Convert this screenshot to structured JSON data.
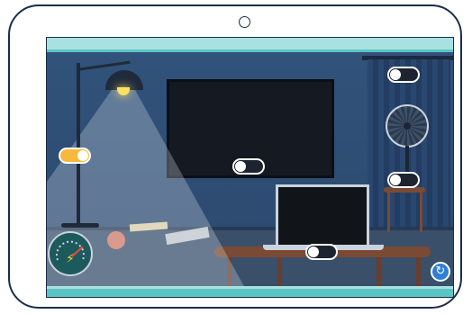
{
  "scene": {
    "accent_color": "#5cc4c4",
    "wall_color": "#31527a",
    "toggle_on_color": "#f6b93b",
    "toggle_off_color": "#1d2430"
  },
  "toggles": [
    {
      "id": "lamp",
      "state": "on"
    },
    {
      "id": "tv",
      "state": "off"
    },
    {
      "id": "fan-top",
      "state": "off"
    },
    {
      "id": "fan",
      "state": "off"
    },
    {
      "id": "laptop",
      "state": "off"
    }
  ],
  "gauge": {
    "icon": "lightning-bolt-icon",
    "glyph": "⚡",
    "level": 0.7
  },
  "controls": {
    "reset_icon": "refresh-icon",
    "reset_glyph": "↻"
  }
}
